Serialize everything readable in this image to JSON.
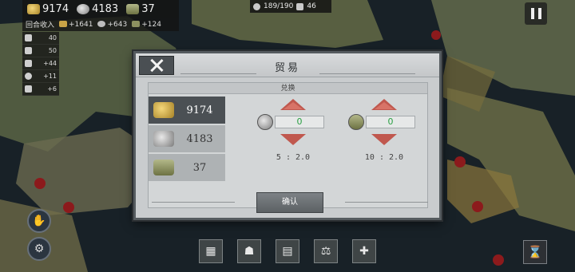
{
  "resources": {
    "gold": "9174",
    "silver": "4183",
    "supply": "37"
  },
  "income": {
    "label": "回合收入",
    "gold": "+1641",
    "silver": "+643",
    "supply": "+124"
  },
  "stats": [
    "40",
    "50",
    "+44",
    "+11",
    "+6"
  ],
  "top_center": {
    "troops": "189/190",
    "count": "46"
  },
  "modal": {
    "title": "贸易",
    "section": "兑换",
    "rows": [
      {
        "name": "gold",
        "value": "9174"
      },
      {
        "name": "silver",
        "value": "4183"
      },
      {
        "name": "supply",
        "value": "37"
      }
    ],
    "exchanges": [
      {
        "value": "0",
        "ratio": "5 : 2.0"
      },
      {
        "value": "0",
        "ratio": "10 : 2.0"
      }
    ],
    "confirm_label": "确认"
  },
  "colors": {
    "accent_arrow": "#c0584e",
    "value_green": "#2aa043"
  }
}
